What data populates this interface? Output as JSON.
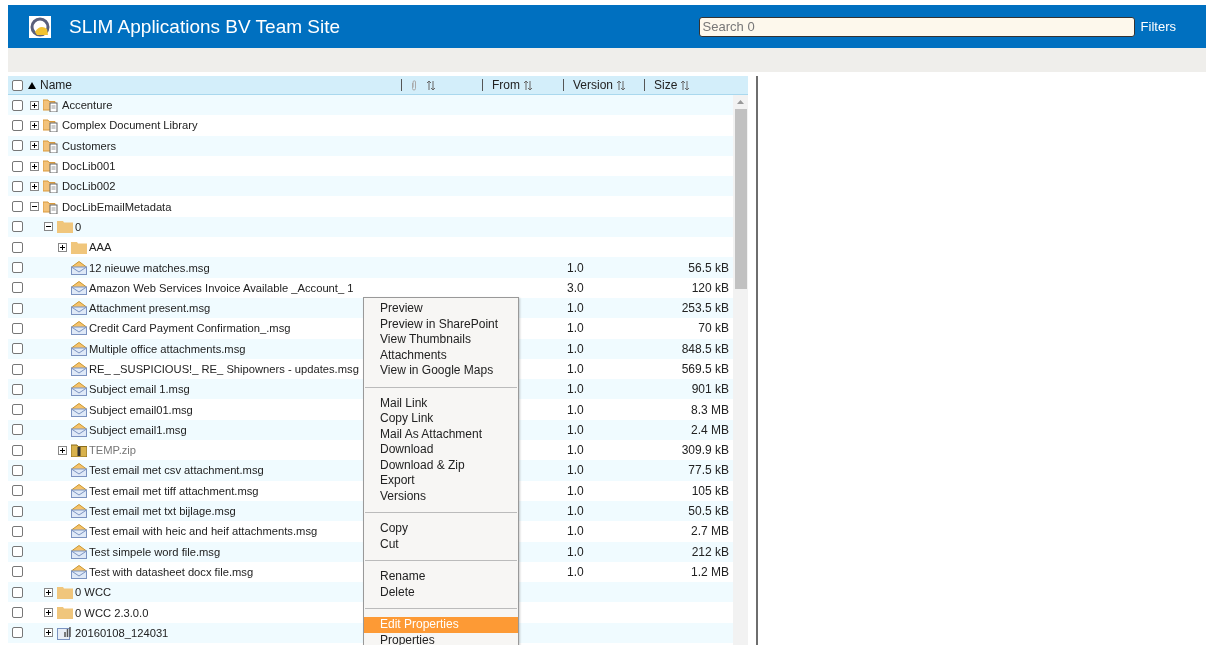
{
  "site": {
    "title": "SLIM Applications BV Team Site",
    "search": {
      "placeholder": "Search 0"
    },
    "filters": "Filters"
  },
  "table": {
    "select_all_checked": false,
    "columns": [
      {
        "kind": "name",
        "label": "Name",
        "sorted": true
      },
      {
        "kind": "attachment",
        "sorted": false
      },
      {
        "kind": "text",
        "label": "From",
        "sorted": false
      },
      {
        "kind": "text",
        "label": "Version",
        "sorted": false
      },
      {
        "kind": "size",
        "label": "Size",
        "sorted": false
      }
    ],
    "rows": [
      {
        "kind": "library",
        "name": "Accenture",
        "checked": false,
        "expanded": false
      },
      {
        "kind": "library",
        "name": "Complex Document Library",
        "checked": false,
        "expanded": false
      },
      {
        "kind": "library",
        "name": "Customers",
        "checked": false,
        "expanded": false
      },
      {
        "kind": "library",
        "name": "DocLib001",
        "checked": false,
        "expanded": false
      },
      {
        "kind": "library",
        "name": "DocLib002",
        "checked": false,
        "expanded": false
      },
      {
        "kind": "library",
        "name": "DocLibEmailMetadata",
        "checked": false,
        "expanded": true,
        "children": [
          {
            "kind": "folder",
            "name": "0",
            "checked": false,
            "expanded": true,
            "children": [
              {
                "kind": "folder",
                "name": "AAA",
                "checked": false,
                "expanded": false
              },
              {
                "kind": "email",
                "name": "12 nieuwe matches.msg",
                "checked": false,
                "version": "1.0",
                "size": "56.5 kB"
              },
              {
                "kind": "email",
                "name": "Amazon Web Services Invoice Available _Account_ 1",
                "checked": false,
                "version": "3.0",
                "size": "120 kB"
              },
              {
                "kind": "email",
                "name": "Attachment present.msg",
                "checked": false,
                "version": "1.0",
                "size": "253.5 kB"
              },
              {
                "kind": "email",
                "name": "Credit Card Payment Confirmation_.msg",
                "checked": false,
                "version": "1.0",
                "size": "70 kB"
              },
              {
                "kind": "email",
                "name": "Multiple office attachments.msg",
                "checked": false,
                "version": "1.0",
                "size": "848.5 kB"
              },
              {
                "kind": "email",
                "name": "RE_ _SUSPICIOUS!_ RE_ Shipowners - updates.msg",
                "checked": false,
                "version": "1.0",
                "size": "569.5 kB"
              },
              {
                "kind": "email",
                "name": "Subject email 1.msg",
                "checked": false,
                "version": "1.0",
                "size": "901 kB"
              },
              {
                "kind": "email",
                "name": "Subject email01.msg",
                "checked": false,
                "version": "1.0",
                "size": "8.3 MB"
              },
              {
                "kind": "email",
                "name": "Subject email1.msg",
                "checked": false,
                "version": "1.0",
                "size": "2.4 MB"
              },
              {
                "kind": "zip",
                "name": "TEMP.zip",
                "checked": false,
                "expanded": false,
                "version": "1.0",
                "size": "309.9 kB"
              },
              {
                "kind": "email",
                "name": "Test email met csv attachment.msg",
                "checked": false,
                "version": "1.0",
                "size": "77.5 kB"
              },
              {
                "kind": "email",
                "name": "Test email met tiff attachment.msg",
                "checked": false,
                "version": "1.0",
                "size": "105 kB"
              },
              {
                "kind": "email",
                "name": "Test email met txt bijlage.msg",
                "checked": false,
                "version": "1.0",
                "size": "50.5 kB"
              },
              {
                "kind": "email",
                "name": "Test email with heic and heif attachments.msg",
                "checked": false,
                "version": "1.0",
                "size": "2.7 MB"
              },
              {
                "kind": "email",
                "name": "Test simpele word file.msg",
                "checked": false,
                "version": "1.0",
                "size": "212 kB"
              },
              {
                "kind": "email",
                "name": "Test with datasheet docx file.msg",
                "checked": false,
                "version": "1.0",
                "size": "1.2 MB"
              }
            ]
          },
          {
            "kind": "folder",
            "name": "0 WCC",
            "checked": false,
            "expanded": false
          },
          {
            "kind": "folder",
            "name": "0 WCC 2.3.0.0",
            "checked": false,
            "expanded": false
          },
          {
            "kind": "site",
            "name": "20160108_124031",
            "checked": false,
            "expanded": false
          }
        ]
      }
    ]
  },
  "context_menu": {
    "groups": [
      {
        "items": [
          {
            "label": "Preview",
            "selected": false
          },
          {
            "label": "Preview in SharePoint",
            "selected": false
          },
          {
            "label": "View Thumbnails",
            "selected": false
          },
          {
            "label": "Attachments",
            "selected": false
          },
          {
            "label": "View in Google Maps",
            "selected": false
          }
        ]
      },
      {
        "items": [
          {
            "label": "Mail Link",
            "selected": false
          },
          {
            "label": "Copy Link",
            "selected": false
          },
          {
            "label": "Mail As Attachment",
            "selected": false
          },
          {
            "label": "Download",
            "selected": false
          },
          {
            "label": "Download & Zip",
            "selected": false
          },
          {
            "label": "Export",
            "selected": false
          },
          {
            "label": "Versions",
            "selected": false
          }
        ]
      },
      {
        "items": [
          {
            "label": "Copy",
            "selected": false
          },
          {
            "label": "Cut",
            "selected": false
          }
        ]
      },
      {
        "items": [
          {
            "label": "Rename",
            "selected": false
          },
          {
            "label": "Delete",
            "selected": false
          }
        ]
      },
      {
        "items": [
          {
            "label": "Edit Properties",
            "selected": true
          },
          {
            "label": "Properties",
            "selected": false
          }
        ]
      }
    ]
  }
}
